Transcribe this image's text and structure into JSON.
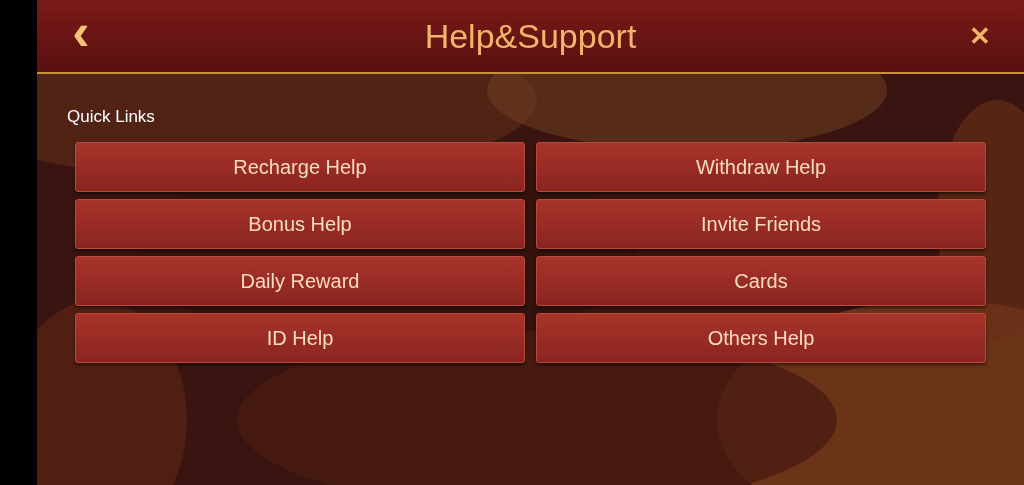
{
  "header": {
    "title": "Help&Support",
    "back": "‹",
    "close": "✕"
  },
  "section": {
    "title": "Quick Links"
  },
  "links": [
    {
      "label": "Recharge Help"
    },
    {
      "label": "Withdraw Help"
    },
    {
      "label": "Bonus Help"
    },
    {
      "label": "Invite Friends"
    },
    {
      "label": "Daily Reward"
    },
    {
      "label": "Cards"
    },
    {
      "label": "ID Help"
    },
    {
      "label": "Others Help"
    }
  ]
}
